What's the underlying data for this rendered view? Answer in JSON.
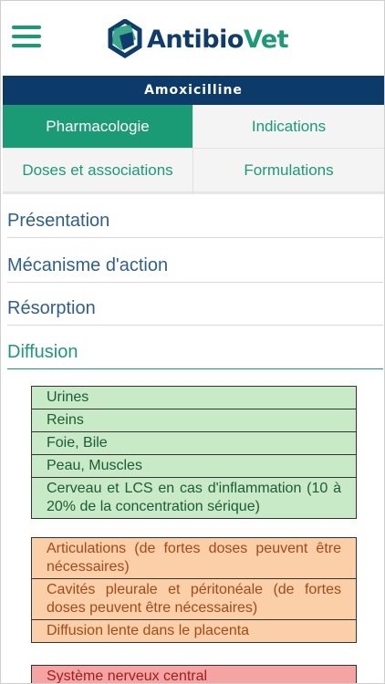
{
  "header": {
    "menu_icon": "hamburger-menu-icon",
    "brand_part1": "Antibio",
    "brand_part2": "Vet",
    "brand_color_primary": "#0e3d6b",
    "brand_color_accent": "#1a9a75"
  },
  "drug": {
    "name": "Amoxicilline"
  },
  "tabs": [
    {
      "label": "Pharmacologie",
      "active": true
    },
    {
      "label": "Indications",
      "active": false
    },
    {
      "label": "Doses et associations",
      "active": false
    },
    {
      "label": "Formulations",
      "active": false
    }
  ],
  "sections": [
    {
      "label": "Présentation"
    },
    {
      "label": "Mécanisme d'action"
    },
    {
      "label": "Résorption"
    },
    {
      "label": "Diffusion",
      "active": true
    }
  ],
  "diffusion": {
    "good": [
      "Urines",
      "Reins",
      "Foie, Bile",
      "Peau, Muscles",
      "Cerveau et LCS en cas d'inflammation (10 à 20% de la concentration sérique)"
    ],
    "moderate": [
      "Articulations (de fortes doses peuvent être nécessaires)",
      "Cavités pleurale et péritonéale (de fortes doses peuvent être nécessaires)",
      "Diffusion lente dans le placenta"
    ],
    "poor": [
      "Système nerveux central"
    ]
  },
  "colors": {
    "green_bg": "#c9eac6",
    "orange_bg": "#fbd0a8",
    "red_bg": "#f6a3a3",
    "header_bar": "#0c3b6a"
  }
}
